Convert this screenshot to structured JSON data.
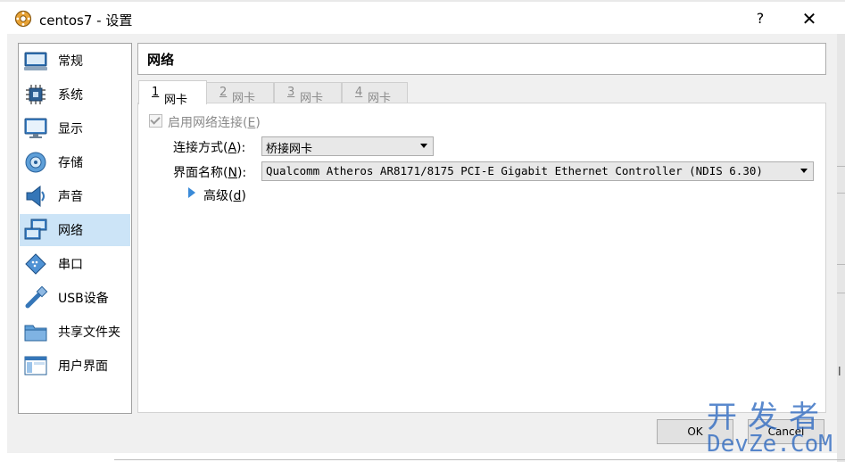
{
  "window": {
    "title": "centos7 - 设置",
    "help_label": "?",
    "close_label": "✕"
  },
  "sidebar": {
    "items": [
      {
        "label": "常规",
        "icon": "general-icon"
      },
      {
        "label": "系统",
        "icon": "system-chip-icon"
      },
      {
        "label": "显示",
        "icon": "display-monitor-icon"
      },
      {
        "label": "存储",
        "icon": "storage-disk-icon"
      },
      {
        "label": "声音",
        "icon": "speaker-icon"
      },
      {
        "label": "网络",
        "icon": "network-icon",
        "selected": true
      },
      {
        "label": "串口",
        "icon": "serial-port-icon"
      },
      {
        "label": "USB设备",
        "icon": "usb-icon"
      },
      {
        "label": "共享文件夹",
        "icon": "shared-folder-icon"
      },
      {
        "label": "用户界面",
        "icon": "user-interface-icon"
      }
    ]
  },
  "section_title": "网络",
  "tabs": [
    {
      "label": "网卡",
      "num": "1",
      "active": true
    },
    {
      "label": "网卡",
      "num": "2",
      "active": false
    },
    {
      "label": "网卡",
      "num": "3",
      "active": false
    },
    {
      "label": "网卡",
      "num": "4",
      "active": false
    }
  ],
  "adapter": {
    "enable_label": "启用网络连接",
    "enable_key": "E",
    "enabled": true,
    "attached_label": "连接方式",
    "attached_key": "A",
    "attached_value": "桥接网卡",
    "name_label": "界面名称",
    "name_key": "N",
    "name_value": "Qualcomm Atheros AR8171/8175 PCI-E Gigabit Ethernet Controller (NDIS 6.30)",
    "advanced_label": "高级",
    "advanced_key": "d"
  },
  "buttons": {
    "ok": "OK",
    "cancel": "Cancel"
  },
  "watermark": {
    "line1": "开发者",
    "line2": "DevZe.CoM"
  },
  "background_fragment": "l",
  "colors": {
    "selection": "#cce4f7",
    "expander": "#3a8ad8",
    "watermark": "#2c68c0"
  }
}
